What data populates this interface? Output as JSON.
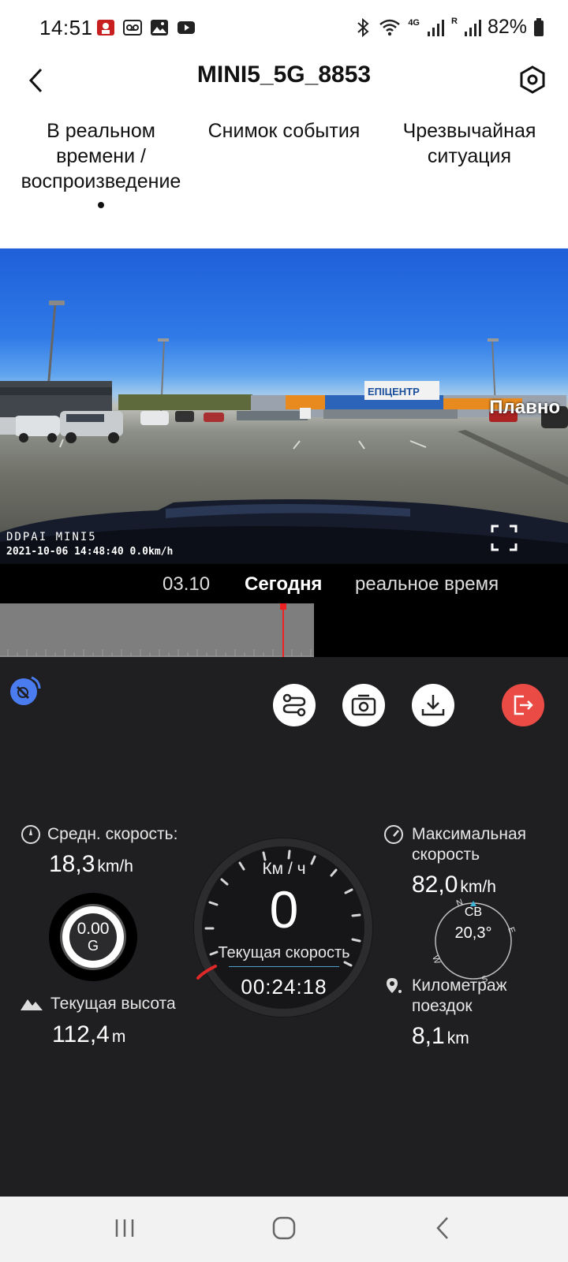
{
  "status_bar": {
    "time": "14:51",
    "battery": "82%",
    "network": "4G",
    "roaming": "R"
  },
  "header": {
    "title": "MINI5_5G_8853"
  },
  "tabs": [
    {
      "label": "В реальном времени / воспроизведение",
      "active": true
    },
    {
      "label": "Снимок события",
      "active": false
    },
    {
      "label": "Чрезвычайная ситуация",
      "active": false
    }
  ],
  "video": {
    "mode_label": "Плавно",
    "brand": "DDPAI MINI5",
    "timestamp": "2021-10-06 14:48:40 0.0km/h",
    "store_sign": "ЕПІЦЕНТР"
  },
  "timeline": {
    "date_label": "03.10",
    "today_label": "Сегодня",
    "live_label": "реальное время"
  },
  "dashboard": {
    "avg_speed": {
      "label": "Средн. скорость:",
      "value": "18,3",
      "unit": "km/h"
    },
    "max_speed": {
      "label_1": "Максимальная",
      "label_2": "скорость",
      "value": "82,0",
      "unit": "km/h"
    },
    "gforce": {
      "value": "0.00",
      "unit": "G"
    },
    "altitude": {
      "label": "Текущая высота",
      "value": "112,4",
      "unit": "m"
    },
    "mileage": {
      "label_1": "Километраж",
      "label_2": "поездок",
      "value": "8,1",
      "unit": "km"
    },
    "gauge": {
      "unit_label": "Км / ч",
      "speed": "0",
      "sub_label": "Текущая скорость",
      "timer": "00:24:18"
    },
    "compass": {
      "direction": "СВ",
      "degrees": "20,3°",
      "n": "N",
      "e": "E",
      "s": "S",
      "w": "W"
    }
  },
  "colors": {
    "dashboard_bg": "#1f1f21",
    "exit_button": "#ea4b45",
    "timeline_cursor": "#ee2222",
    "gps_icon": "#4a7cf0"
  },
  "icons": {
    "back": "chevron-left-icon",
    "settings": "hexagon-gear-icon",
    "gps": "satellite-icon",
    "route": "route-icon",
    "snapshot": "camera-icon",
    "download": "download-icon",
    "exit": "exit-icon",
    "fullscreen": "fullscreen-icon"
  }
}
